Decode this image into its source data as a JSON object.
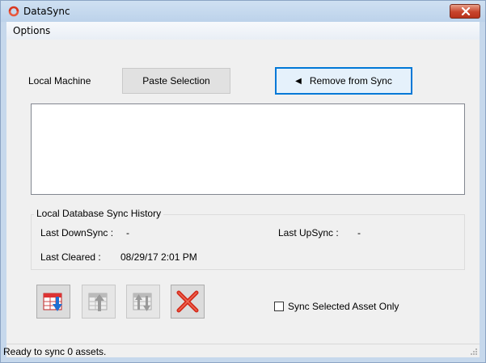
{
  "window": {
    "title": "DataSync",
    "icon": "datasync-logo-icon",
    "close_icon": "close-icon",
    "accent_color": "#0078d7",
    "close_color": "#c7432b"
  },
  "menu": {
    "items": [
      {
        "label": "Options"
      }
    ]
  },
  "top_row": {
    "local_label": "Local Machine",
    "paste_label": "Paste Selection",
    "remove_label": "Remove from Sync",
    "remove_icon": "triangle-left-icon"
  },
  "listbox": {
    "items": []
  },
  "history": {
    "title": "Local Database Sync History",
    "last_downsync_label": "Last DownSync :",
    "last_downsync_value": "-",
    "last_upsync_label": "Last UpSync :",
    "last_upsync_value": "-",
    "last_cleared_label": "Last Cleared :",
    "last_cleared_value": "08/29/17 2:01 PM"
  },
  "toolbar": {
    "buttons": [
      {
        "icon": "downsync-icon",
        "enabled": true
      },
      {
        "icon": "upsync-icon",
        "enabled": false
      },
      {
        "icon": "sync-both-icon",
        "enabled": false
      },
      {
        "icon": "delete-x-icon",
        "enabled": true
      }
    ]
  },
  "options": {
    "sync_selected_label": "Sync Selected Asset Only",
    "sync_selected_checked": false
  },
  "status": {
    "text": "Ready to sync 0 assets.",
    "grip_icon": "resize-grip-icon"
  }
}
